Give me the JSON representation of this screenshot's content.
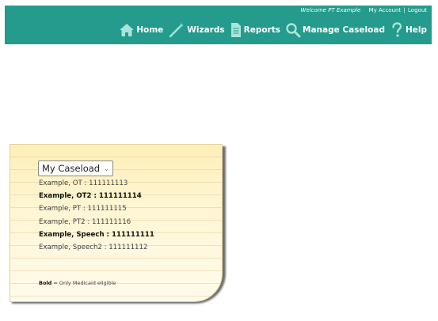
{
  "header": {
    "welcome": "Welcome PT Example",
    "my_account": "My Account",
    "separator": "|",
    "logout": "Logout",
    "nav": [
      {
        "label": "Home",
        "icon": "home-icon"
      },
      {
        "label": "Wizards",
        "icon": "wand-icon"
      },
      {
        "label": "Reports",
        "icon": "document-icon"
      },
      {
        "label": "Manage Caseload",
        "icon": "search-icon"
      },
      {
        "label": "Help",
        "icon": "question-icon"
      }
    ]
  },
  "caseload": {
    "selected": "My Caseload",
    "patients": [
      {
        "text": "Example, OT : 111111113",
        "bold": false
      },
      {
        "text": "Example, OT2 : 111111114",
        "bold": true
      },
      {
        "text": "Example, PT : 111111115",
        "bold": false
      },
      {
        "text": "Example, PT2 : 111111116",
        "bold": false
      },
      {
        "text": "Example, Speech : 111111111",
        "bold": true
      },
      {
        "text": "Example, Speech2 : 111111112",
        "bold": false
      }
    ],
    "legend_bold": "Bold",
    "legend_rest": " = Only Medicaid eligible"
  },
  "colors": {
    "header_bg": "#249b8c",
    "card_bg": "#fdefb9",
    "icon_light": "#a8e6d9"
  }
}
